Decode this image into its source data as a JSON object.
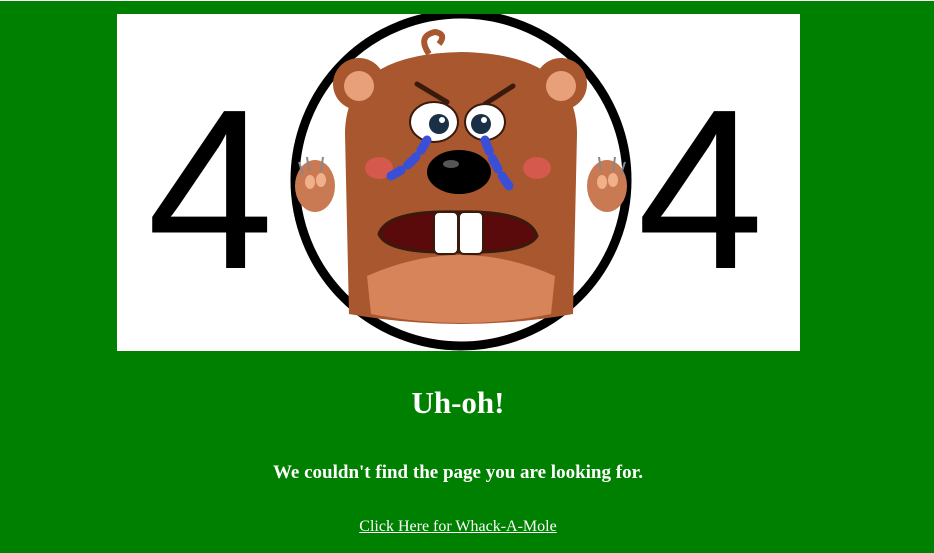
{
  "illustration": {
    "digit_left": "4",
    "digit_right": "4",
    "icon": "crying-mole-icon"
  },
  "content": {
    "heading": "Uh-oh!",
    "message": "We couldn't find the page you are looking for.",
    "link_text": "Click Here for Whack-A-Mole"
  },
  "colors": {
    "background": "#008000",
    "text": "#ffffff",
    "image_background": "#ffffff"
  }
}
